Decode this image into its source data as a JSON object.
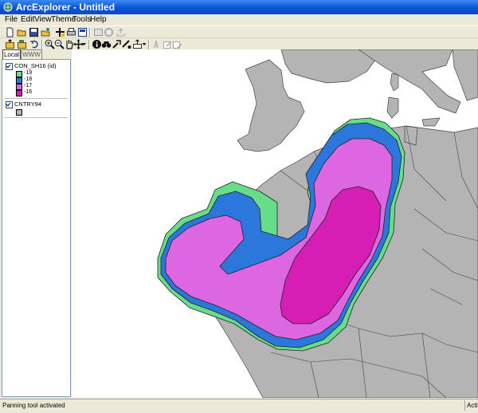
{
  "window": {
    "title": "ArcExplorer - Untitled",
    "app_icon": "globe-icon"
  },
  "menu": {
    "items": [
      "File",
      "Edit",
      "View",
      "Theme",
      "Tools",
      "Help"
    ]
  },
  "toolbar1": {
    "buttons": [
      "new-icon",
      "open-icon",
      "save-icon",
      "open-project-icon",
      "add-theme-icon",
      "print-icon",
      "layout-icon",
      "add-image-icon",
      "delete-icon",
      "export-icon"
    ]
  },
  "toolbar2": {
    "buttons": [
      "add-theme-icon",
      "project-icon",
      "undo-icon",
      "zoom-in-icon",
      "zoom-out-icon",
      "pan-icon",
      "full-extent-icon",
      "identify-icon",
      "find-icon",
      "hyperlink-icon",
      "query-icon",
      "select-icon",
      "label-icon",
      "edit-icon"
    ]
  },
  "tabs": {
    "local": "Local",
    "www": "WWW"
  },
  "legend": {
    "layer1": {
      "name": "CON_SH16 (id)",
      "classes": [
        {
          "label": "-19",
          "color": "#66dd88"
        },
        {
          "label": "-18",
          "color": "#2b77dc"
        },
        {
          "label": "-17",
          "color": "#dd66e2"
        },
        {
          "label": "-16",
          "color": "#d61eb4"
        }
      ]
    },
    "layer2": {
      "name": "CNTRY94",
      "color": "#b4b4b4"
    }
  },
  "status": {
    "text": "Panning tool activated",
    "panel": "Active"
  }
}
